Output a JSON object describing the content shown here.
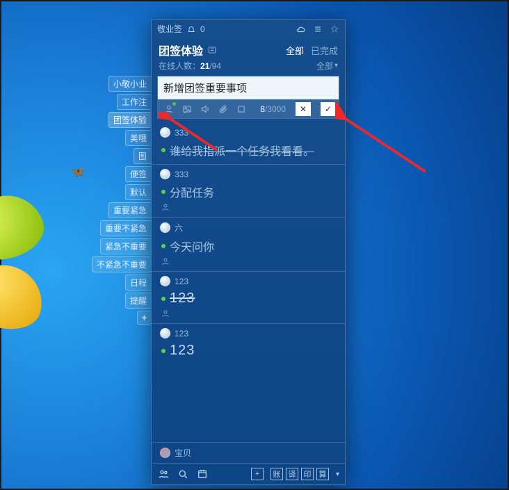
{
  "titlebar": {
    "app_name": "敬业签",
    "notif_count": "0"
  },
  "header": {
    "title": "团签体验",
    "tab_all": "全部",
    "tab_done": "已完成"
  },
  "subheader": {
    "label_prefix": "在线人数：",
    "online": "21",
    "total": "/94",
    "filter_all": "全部"
  },
  "compose": {
    "text": "新增团签重要事项",
    "count_current": "8",
    "count_max": "/3000"
  },
  "side_tags": [
    "小敬小业",
    "工作注",
    "团签体验",
    "美哦",
    "图",
    "便签",
    "默认",
    "重要紧急",
    "重要不紧急",
    "紧急不重要",
    "不紧急不重要",
    "日程",
    "提醒"
  ],
  "side_add": "+",
  "items": [
    {
      "author": "333",
      "text": "谁给我指派一个任务我看看。",
      "strike": true,
      "subicon": false,
      "big": false
    },
    {
      "author": "333",
      "text": "分配任务",
      "strike": false,
      "subicon": true,
      "big": false
    },
    {
      "author": "六",
      "text": "今天问你",
      "strike": false,
      "subicon": true,
      "big": false
    },
    {
      "author": "123",
      "text": "123",
      "strike": true,
      "subicon": true,
      "big": true
    },
    {
      "author": "123",
      "text": "123",
      "strike": false,
      "subicon": false,
      "big": true
    }
  ],
  "footer_user": "宝贝",
  "footer_buttons": [
    "账",
    "译",
    "印",
    "算"
  ]
}
